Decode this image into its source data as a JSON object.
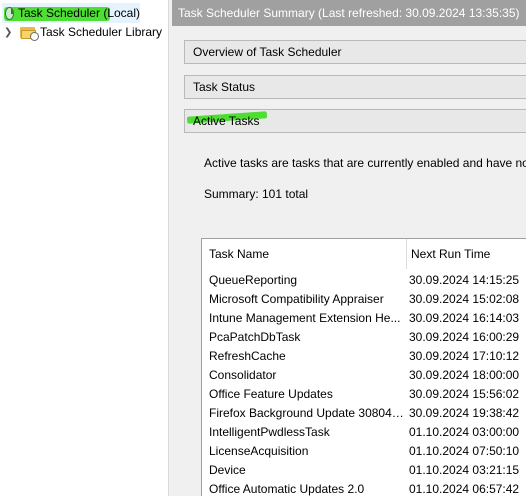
{
  "tree": {
    "root_label": "Task Scheduler (Local)",
    "library_label": "Task Scheduler Library"
  },
  "summary": {
    "title": "Task Scheduler Summary (Last refreshed: 30.09.2024 13:35:35)",
    "sections": {
      "overview": "Overview of Task Scheduler",
      "status": "Task Status",
      "active": "Active Tasks"
    },
    "active_description": "Active tasks are tasks that are currently enabled and have not",
    "summary_text": "Summary: 101 total",
    "table": {
      "columns": [
        "Task Name",
        "Next Run Time"
      ],
      "rows": [
        [
          "QueueReporting",
          "30.09.2024 14:15:25"
        ],
        [
          "Microsoft Compatibility Appraiser",
          "30.09.2024 15:02:08"
        ],
        [
          "Intune Management Extension He...",
          "30.09.2024 16:14:03"
        ],
        [
          "PcaPatchDbTask",
          "30.09.2024 16:00:29"
        ],
        [
          "RefreshCache",
          "30.09.2024 17:10:12"
        ],
        [
          "Consolidator",
          "30.09.2024 18:00:00"
        ],
        [
          "Office Feature Updates",
          "30.09.2024 15:56:02"
        ],
        [
          "Firefox Background Update 308046...",
          "30.09.2024 19:38:42"
        ],
        [
          "IntelligentPwdlessTask",
          "01.10.2024 03:00:00"
        ],
        [
          "LicenseAcquisition",
          "01.10.2024 07:50:10"
        ],
        [
          "Device",
          "01.10.2024 03:21:15"
        ],
        [
          "Office Automatic Updates 2.0",
          "01.10.2024 06:57:42"
        ]
      ]
    }
  },
  "colors": {
    "highlight_green": "#3ddc1e",
    "title_bar": "#a0a0a0",
    "pane_bg": "#f0f0f0"
  },
  "icons": {
    "root": "clock-icon",
    "library": "folder-clock-icon",
    "expand": "chevron-right-icon"
  }
}
